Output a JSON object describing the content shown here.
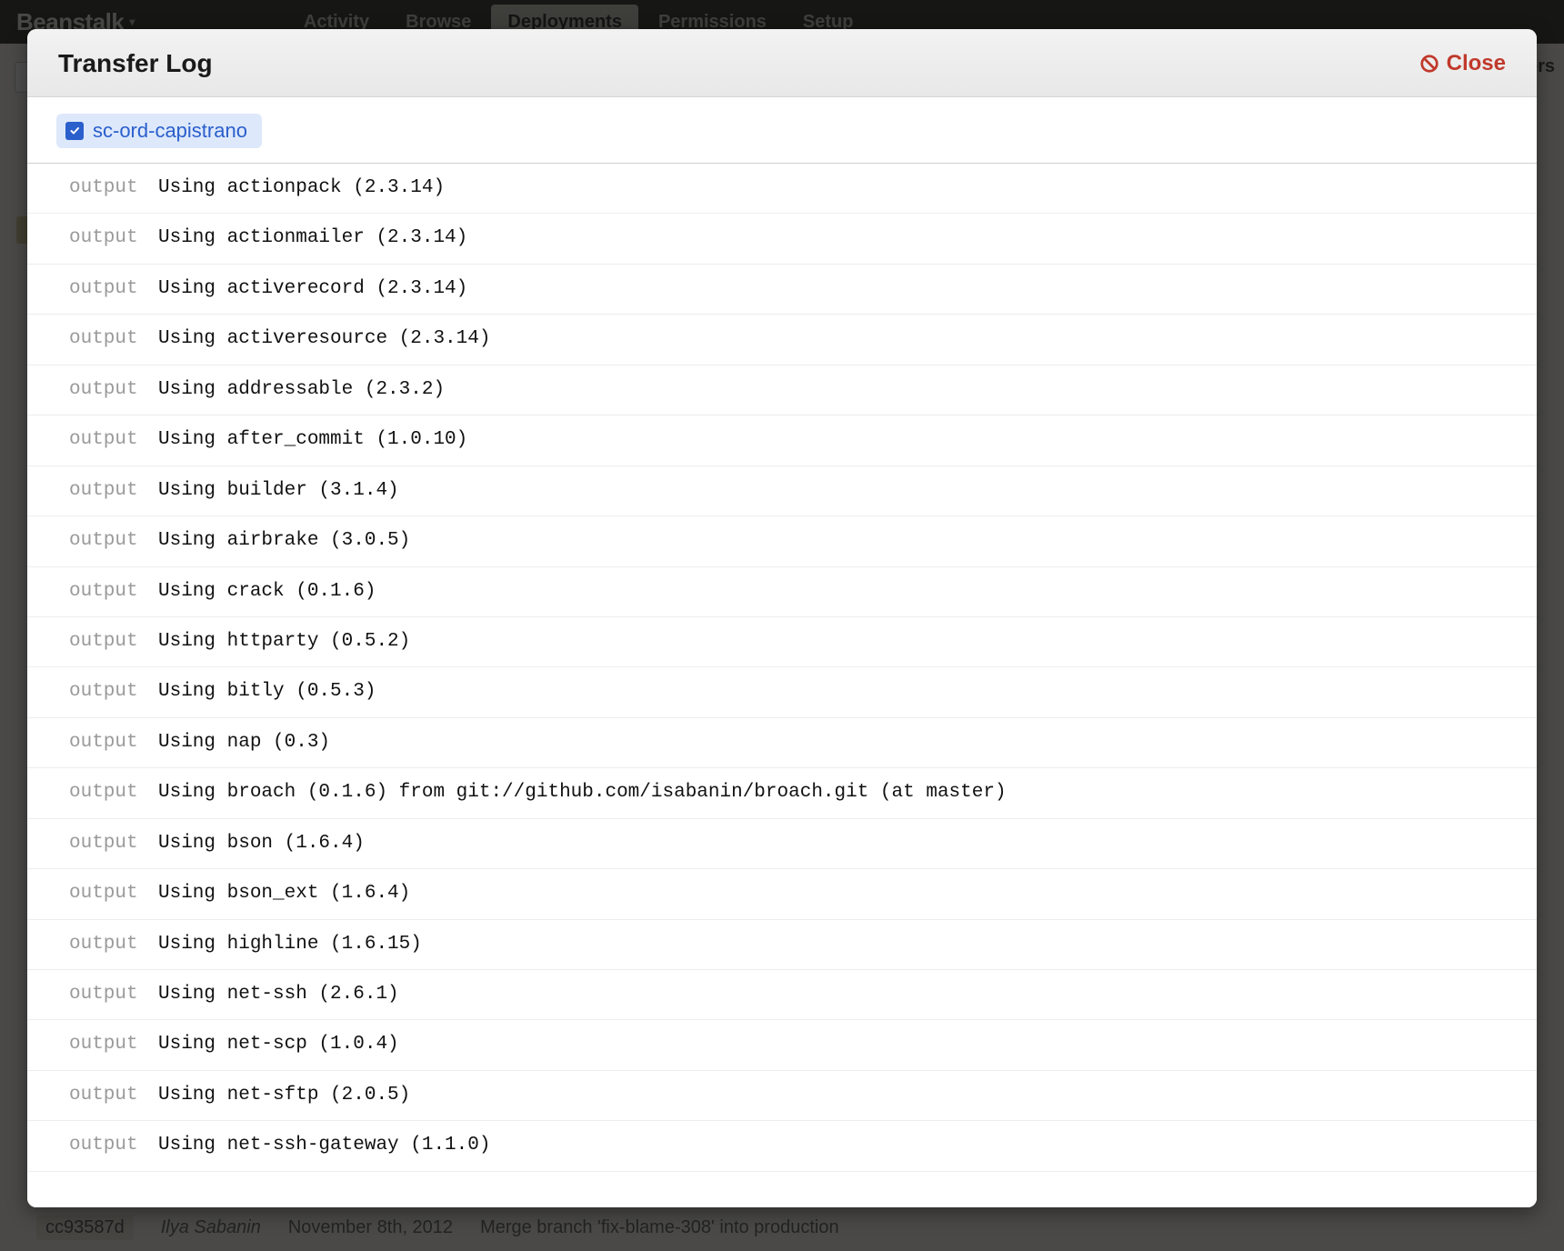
{
  "app": {
    "brand": "Beanstalk",
    "nav": [
      "Activity",
      "Browse",
      "Deployments",
      "Permissions",
      "Setup"
    ],
    "active_nav_index": 2,
    "side_right_hint": "...ers",
    "footer": {
      "hash": "cc93587d",
      "author": "Ilya Sabanin",
      "date": "November 8th, 2012",
      "message": "Merge branch 'fix-blame-308' into production"
    }
  },
  "modal": {
    "title": "Transfer Log",
    "close_label": "Close",
    "server_tag": "sc-ord-capistrano",
    "rows": [
      {
        "type": "output",
        "msg": "Using actionpack (2.3.14)"
      },
      {
        "type": "output",
        "msg": "Using actionmailer (2.3.14)"
      },
      {
        "type": "output",
        "msg": "Using activerecord (2.3.14)"
      },
      {
        "type": "output",
        "msg": "Using activeresource (2.3.14)"
      },
      {
        "type": "output",
        "msg": "Using addressable (2.3.2)"
      },
      {
        "type": "output",
        "msg": "Using after_commit (1.0.10)"
      },
      {
        "type": "output",
        "msg": "Using builder (3.1.4)"
      },
      {
        "type": "output",
        "msg": "Using airbrake (3.0.5)"
      },
      {
        "type": "output",
        "msg": "Using crack (0.1.6)"
      },
      {
        "type": "output",
        "msg": "Using httparty (0.5.2)"
      },
      {
        "type": "output",
        "msg": "Using bitly (0.5.3)"
      },
      {
        "type": "output",
        "msg": "Using nap (0.3)"
      },
      {
        "type": "output",
        "msg": "Using broach (0.1.6) from git://github.com/isabanin/broach.git (at master)"
      },
      {
        "type": "output",
        "msg": "Using bson (1.6.4)"
      },
      {
        "type": "output",
        "msg": "Using bson_ext (1.6.4)"
      },
      {
        "type": "output",
        "msg": "Using highline (1.6.15)"
      },
      {
        "type": "output",
        "msg": "Using net-ssh (2.6.1)"
      },
      {
        "type": "output",
        "msg": "Using net-scp (1.0.4)"
      },
      {
        "type": "output",
        "msg": "Using net-sftp (2.0.5)"
      },
      {
        "type": "output",
        "msg": "Using net-ssh-gateway (1.1.0)"
      }
    ]
  }
}
